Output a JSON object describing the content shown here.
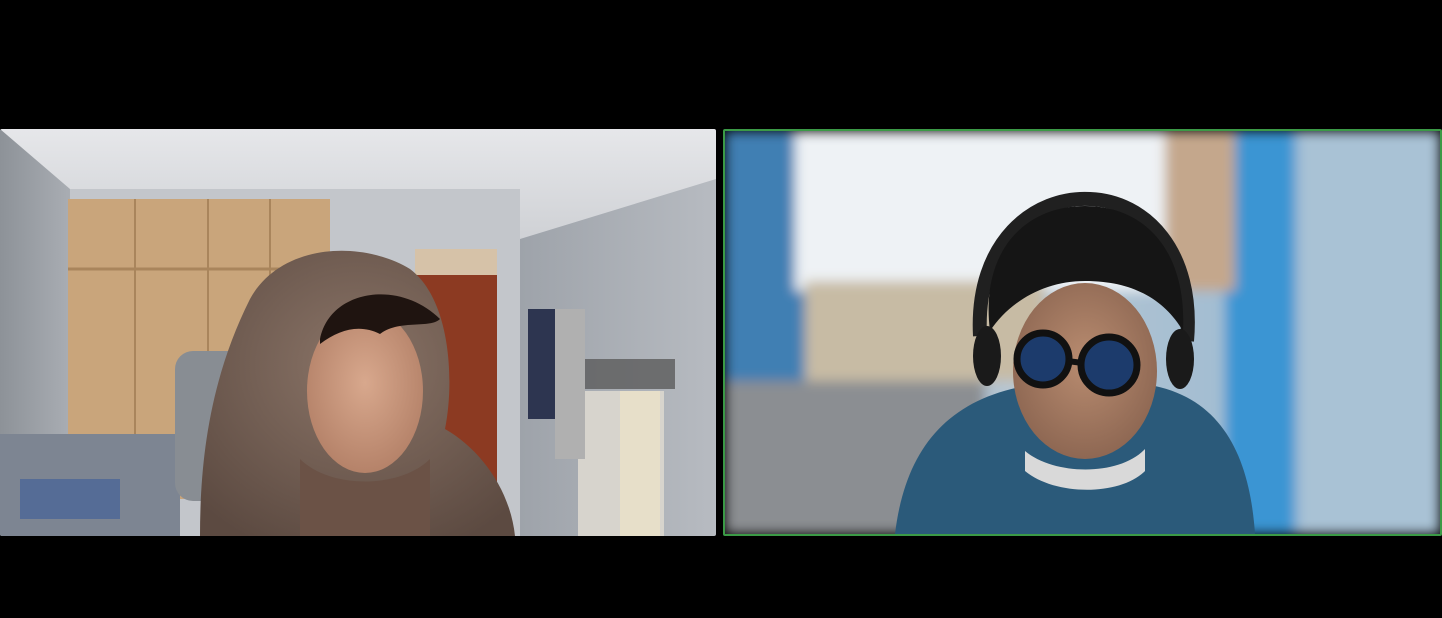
{
  "call": {
    "participants": [
      {
        "position": "left",
        "active_speaker": false
      },
      {
        "position": "right",
        "active_speaker": true
      }
    ],
    "colors": {
      "background": "#000000",
      "active_speaker_border": "#3b9a46"
    }
  }
}
